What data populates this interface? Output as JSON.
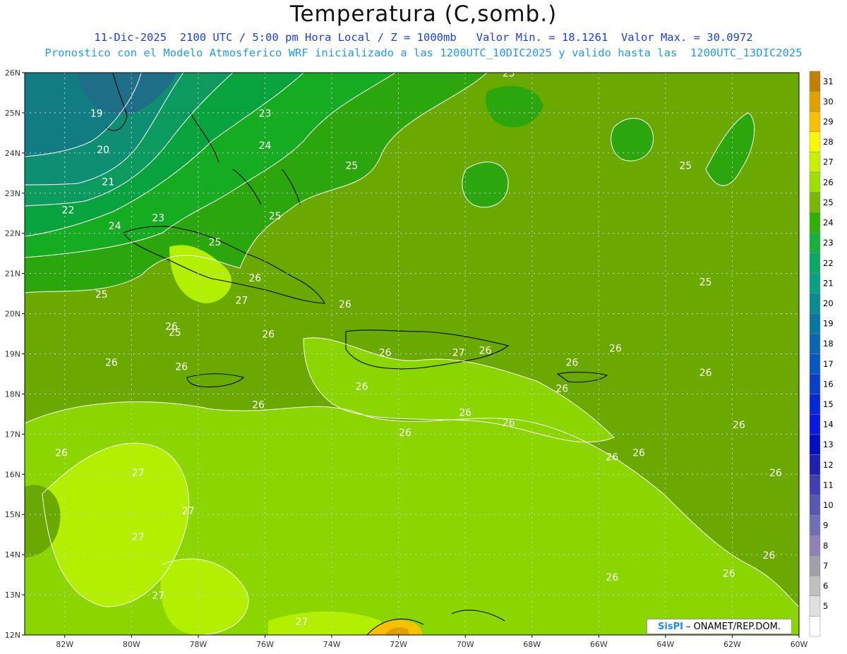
{
  "header": {
    "title": "Temperatura (C,somb.)",
    "line1": "11-Dic-2025  2100 UTC / 5:00 pm Hora Local / Z = 1000mb   Valor Min. = 18.1261  Valor Max. = 30.0972",
    "line2": "Pronostico con el Modelo Atmosferico WRF inicializado a las 1200UTC_10DIC2025 y valido hasta las  1200UTC_13DIC2025"
  },
  "map": {
    "lat_labels": [
      "26N",
      "25N",
      "24N",
      "23N",
      "22N",
      "21N",
      "20N",
      "19N",
      "18N",
      "17N",
      "16N",
      "15N",
      "14N",
      "13N",
      "12N"
    ],
    "lon_labels": [
      "82W",
      "80W",
      "78W",
      "76W",
      "74W",
      "72W",
      "70W",
      "68W",
      "66W",
      "64W",
      "62W",
      "60W"
    ],
    "contour_labels": [
      {
        "text": "19",
        "lon": -81.05,
        "lat": 24.9
      },
      {
        "text": "20",
        "lon": -80.85,
        "lat": 24.0
      },
      {
        "text": "21",
        "lon": -80.7,
        "lat": 23.2
      },
      {
        "text": "22",
        "lon": -81.9,
        "lat": 22.5
      },
      {
        "text": "23",
        "lon": -79.2,
        "lat": 22.3
      },
      {
        "text": "24",
        "lon": -80.5,
        "lat": 22.1
      },
      {
        "text": "23",
        "lon": -76.0,
        "lat": 24.9
      },
      {
        "text": "24",
        "lon": -76.0,
        "lat": 24.1
      },
      {
        "text": "25",
        "lon": -73.4,
        "lat": 23.6
      },
      {
        "text": "25",
        "lon": -75.7,
        "lat": 22.35
      },
      {
        "text": "25",
        "lon": -80.9,
        "lat": 20.4
      },
      {
        "text": "25",
        "lon": -68.7,
        "lat": 25.9
      },
      {
        "text": "25",
        "lon": -63.4,
        "lat": 23.6
      },
      {
        "text": "25",
        "lon": -62.8,
        "lat": 20.7
      },
      {
        "text": "25",
        "lon": -77.5,
        "lat": 21.7
      },
      {
        "text": "26",
        "lon": -76.3,
        "lat": 20.8
      },
      {
        "text": "27",
        "lon": -76.7,
        "lat": 20.25
      },
      {
        "text": "26",
        "lon": -78.8,
        "lat": 19.6
      },
      {
        "text": "25",
        "lon": -78.7,
        "lat": 19.45
      },
      {
        "text": "26",
        "lon": -75.9,
        "lat": 19.4
      },
      {
        "text": "26",
        "lon": -80.6,
        "lat": 18.7
      },
      {
        "text": "26",
        "lon": -78.5,
        "lat": 18.6
      },
      {
        "text": "26",
        "lon": -73.6,
        "lat": 20.15
      },
      {
        "text": "26",
        "lon": -72.4,
        "lat": 18.95
      },
      {
        "text": "27",
        "lon": -70.2,
        "lat": 18.95
      },
      {
        "text": "26",
        "lon": -69.4,
        "lat": 19.0
      },
      {
        "text": "26",
        "lon": -73.1,
        "lat": 18.1
      },
      {
        "text": "26",
        "lon": -70.0,
        "lat": 17.45
      },
      {
        "text": "26",
        "lon": -68.7,
        "lat": 17.2
      },
      {
        "text": "26",
        "lon": -71.8,
        "lat": 16.95
      },
      {
        "text": "26",
        "lon": -66.8,
        "lat": 18.7
      },
      {
        "text": "26",
        "lon": -67.1,
        "lat": 18.05
      },
      {
        "text": "26",
        "lon": -65.5,
        "lat": 19.05
      },
      {
        "text": "26",
        "lon": -62.8,
        "lat": 18.45
      },
      {
        "text": "26",
        "lon": -61.8,
        "lat": 17.15
      },
      {
        "text": "26",
        "lon": -64.8,
        "lat": 16.45
      },
      {
        "text": "26",
        "lon": -65.6,
        "lat": 16.35
      },
      {
        "text": "26",
        "lon": -60.7,
        "lat": 15.95
      },
      {
        "text": "26",
        "lon": -76.2,
        "lat": 17.65
      },
      {
        "text": "26",
        "lon": -82.1,
        "lat": 16.45
      },
      {
        "text": "27",
        "lon": -79.8,
        "lat": 15.95
      },
      {
        "text": "27",
        "lon": -78.3,
        "lat": 15.0
      },
      {
        "text": "27",
        "lon": -79.8,
        "lat": 14.35
      },
      {
        "text": "26",
        "lon": -60.9,
        "lat": 13.9
      },
      {
        "text": "26",
        "lon": -62.1,
        "lat": 13.45
      },
      {
        "text": "26",
        "lon": -65.6,
        "lat": 13.35
      },
      {
        "text": "27",
        "lon": -79.2,
        "lat": 12.9
      },
      {
        "text": "27",
        "lon": -74.9,
        "lat": 12.25
      }
    ],
    "colors": {
      "bg_25": "#6aaa00",
      "band_19": "#117c82",
      "band_20": "#0e8f74",
      "band_21": "#0d9a5e",
      "band_22": "#08a33e",
      "band_23": "#15ac21",
      "band_24": "#2ba60c",
      "band_26": "#8cd600",
      "band_27": "#b2f000",
      "band_28": "#e8f800",
      "band_29": "#f8c000",
      "band_30": "#e0a000"
    }
  },
  "colorbar": {
    "levels": [
      {
        "label": "31",
        "color": "#c08000"
      },
      {
        "label": "30",
        "color": "#e0a000"
      },
      {
        "label": "29",
        "color": "#f8c000"
      },
      {
        "label": "28",
        "color": "#f8f800"
      },
      {
        "label": "27",
        "color": "#c8f000"
      },
      {
        "label": "26",
        "color": "#a0e000"
      },
      {
        "label": "25",
        "color": "#78b800"
      },
      {
        "label": "24",
        "color": "#30b000"
      },
      {
        "label": "23",
        "color": "#18b040"
      },
      {
        "label": "22",
        "color": "#08a868"
      },
      {
        "label": "21",
        "color": "#08a080"
      },
      {
        "label": "20",
        "color": "#088c90"
      },
      {
        "label": "19",
        "color": "#0878a0"
      },
      {
        "label": "18",
        "color": "#0868b0"
      },
      {
        "label": "17",
        "color": "#0858c0"
      },
      {
        "label": "16",
        "color": "#0840c8"
      },
      {
        "label": "15",
        "color": "#0828d8"
      },
      {
        "label": "14",
        "color": "#0818e0"
      },
      {
        "label": "13",
        "color": "#0010c0"
      },
      {
        "label": "12",
        "color": "#2020b0"
      },
      {
        "label": "11",
        "color": "#4040b0"
      },
      {
        "label": "10",
        "color": "#5858b0"
      },
      {
        "label": "9",
        "color": "#7070b8"
      },
      {
        "label": "8",
        "color": "#9080b8"
      },
      {
        "label": "7",
        "color": "#a0a0a8"
      },
      {
        "label": "6",
        "color": "#c0c0c0"
      },
      {
        "label": "5",
        "color": "#e0e0e0"
      },
      {
        "label": "",
        "color": "#ffffff"
      }
    ]
  },
  "credit": {
    "brand": "SisPI",
    "text": "– ONAMET/REP.DOM."
  }
}
